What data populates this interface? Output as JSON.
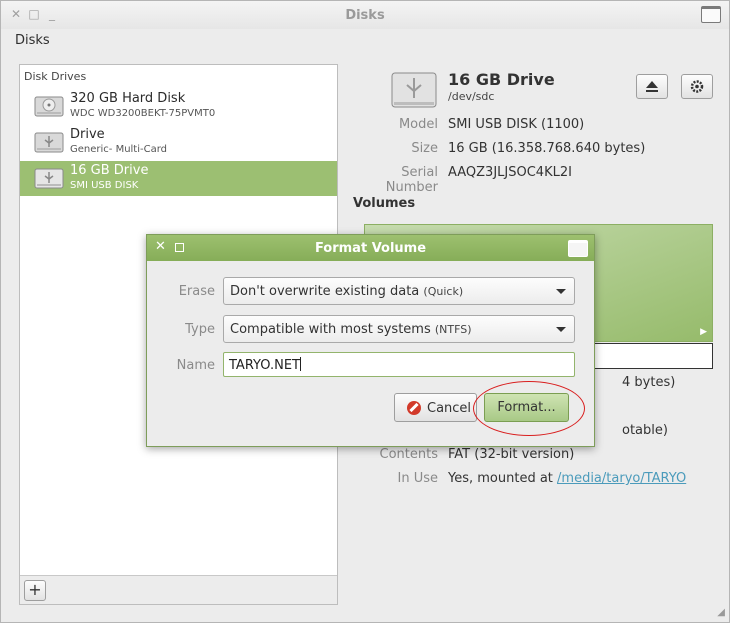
{
  "window": {
    "title": "Disks",
    "close_glyph": "✕",
    "min_glyph": "□",
    "menu_glyph": "_"
  },
  "app_menu": "Disks",
  "sidebar": {
    "header": "Disk Drives",
    "drives": [
      {
        "name": "320 GB Hard Disk",
        "sub": "WDC WD3200BEKT-75PVMT0",
        "icon": "harddisk-icon"
      },
      {
        "name": "Drive",
        "sub": "Generic- Multi-Card",
        "icon": "usb-drive-icon"
      },
      {
        "name": "16 GB Drive",
        "sub": "SMI USB DISK",
        "icon": "usb-drive-icon",
        "selected": true
      }
    ],
    "add_label": "+"
  },
  "drive": {
    "title": "16 GB Drive",
    "device": "/dev/sdc",
    "props": {
      "model_label": "Model",
      "model": "SMI USB DISK (1100)",
      "size_label": "Size",
      "size": "16 GB (16.358.768.640 bytes)",
      "serial_label": "Serial Number",
      "serial": "AAQZ3JLJSOC4KL2I"
    }
  },
  "volumes": {
    "heading": "Volumes",
    "partial_size_suffix": "4 bytes)",
    "partial_type_suffix": "otable)",
    "contents_label": "Contents",
    "contents": "FAT (32-bit version)",
    "inuse_label": "In Use",
    "inuse_prefix": "Yes, mounted at ",
    "inuse_link": "/media/taryo/TARYO"
  },
  "dialog": {
    "title": "Format Volume",
    "erase_label": "Erase",
    "erase_value": "Don't overwrite existing data",
    "erase_sub": "(Quick)",
    "type_label": "Type",
    "type_value": "Compatible with most systems",
    "type_sub": "(NTFS)",
    "name_label": "Name",
    "name_value": "TARYO.NET",
    "cancel_label": "Cancel",
    "format_label": "Format..."
  },
  "colors": {
    "accent": "#9cbf72",
    "highlight_circle": "#d92020",
    "link": "#4b9bbb"
  }
}
